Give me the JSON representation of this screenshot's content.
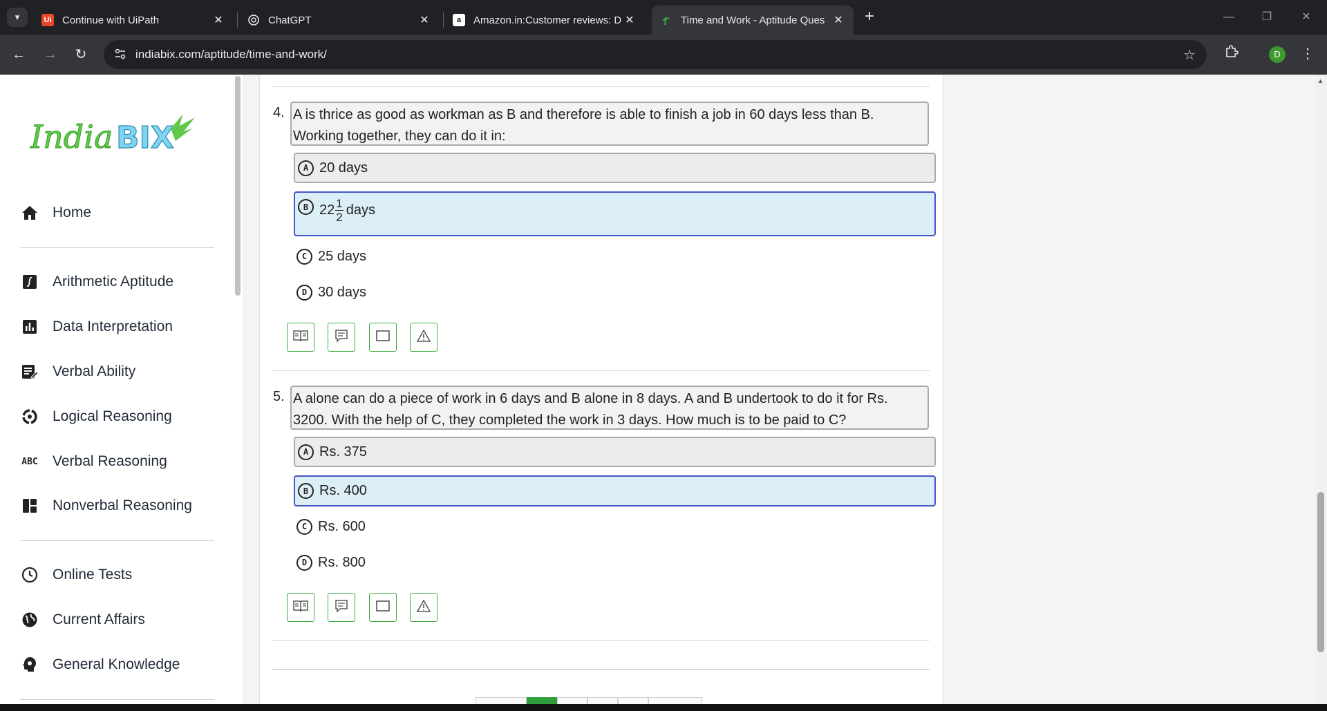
{
  "browser": {
    "tabs": [
      {
        "title": "Continue with UiPath",
        "favicon": "uipath-icon",
        "favicon_text": "Ui",
        "favicon_color": "#e8482a",
        "active": false
      },
      {
        "title": "ChatGPT",
        "favicon": "chatgpt-icon",
        "active": false
      },
      {
        "title": "Amazon.in:Customer reviews: D",
        "favicon": "amazon-icon",
        "favicon_text": "a",
        "active": false
      },
      {
        "title": "Time and Work - Aptitude Ques",
        "favicon": "indiabix-icon",
        "active": true
      }
    ],
    "url": "indiabix.com/aptitude/time-and-work/",
    "profile_initial": "D",
    "profile_color": "#3c9a2f"
  },
  "sidebar": {
    "logo_text": "IndiaBIX",
    "items": [
      {
        "label": "Home",
        "icon": "home-icon"
      },
      {
        "label": "Arithmetic Aptitude",
        "icon": "integral-icon"
      },
      {
        "label": "Data Interpretation",
        "icon": "bar-chart-icon"
      },
      {
        "label": "Verbal Ability",
        "icon": "document-edit-icon"
      },
      {
        "label": "Logical Reasoning",
        "icon": "logic-cycle-icon"
      },
      {
        "label": "Verbal Reasoning",
        "icon": "abc-icon",
        "icon_text": "ABC"
      },
      {
        "label": "Nonverbal Reasoning",
        "icon": "dashboard-grid-icon"
      },
      {
        "label": "Online Tests",
        "icon": "clock-icon"
      },
      {
        "label": "Current Affairs",
        "icon": "globe-icon"
      },
      {
        "label": "General Knowledge",
        "icon": "lightbulb-head-icon"
      }
    ]
  },
  "questions": [
    {
      "number": "4.",
      "text": "A is thrice as good as workman as B and therefore is able to finish a job in 60 days less than B. Working together, they can do it in:",
      "options": [
        {
          "letter": "A",
          "text": "20 days",
          "style": "boxed"
        },
        {
          "letter": "B",
          "whole": "22",
          "frac_num": "1",
          "frac_den": "2",
          "text": "days",
          "style": "selected"
        },
        {
          "letter": "C",
          "text": "25 days",
          "style": "plain"
        },
        {
          "letter": "D",
          "text": "30 days",
          "style": "plain"
        }
      ]
    },
    {
      "number": "5.",
      "text": "A alone can do a piece of work in 6 days and B alone in 8 days. A and B undertook to do it for Rs. 3200. With the help of C, they completed the work in 3 days. How much is to be paid to C?",
      "options": [
        {
          "letter": "A",
          "text": "Rs. 375",
          "style": "boxed"
        },
        {
          "letter": "B",
          "text": "Rs. 400",
          "style": "selected"
        },
        {
          "letter": "C",
          "text": "Rs. 600",
          "style": "plain"
        },
        {
          "letter": "D",
          "text": "Rs. 800",
          "style": "plain"
        }
      ]
    }
  ],
  "action_buttons": [
    "answer-book-icon",
    "discuss-icon",
    "workspace-icon",
    "report-warning-icon"
  ],
  "colors": {
    "accent_green": "#3cab3c",
    "selected_border": "#4455cc",
    "selected_bg": "#dceef6"
  }
}
